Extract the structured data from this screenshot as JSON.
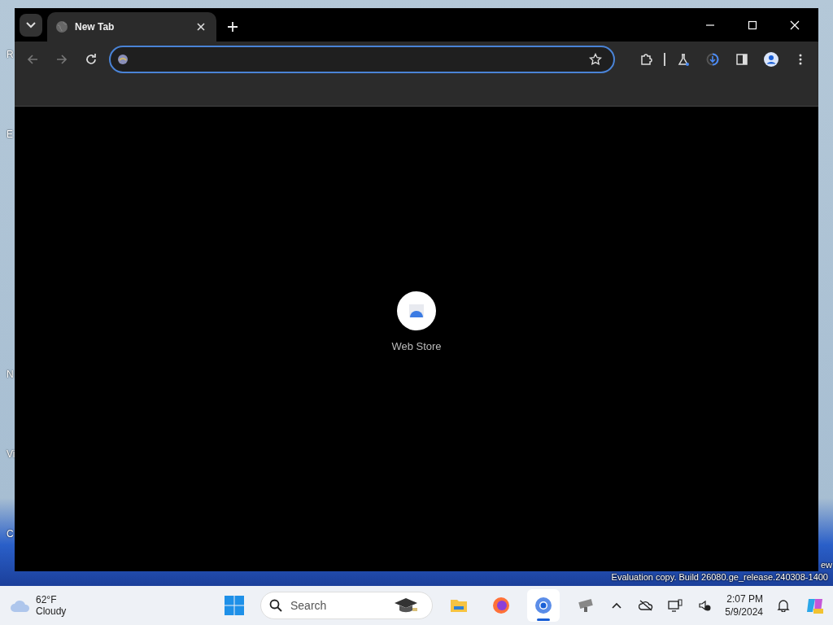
{
  "desktop": {
    "icon_labels": [
      "R",
      "E",
      "N",
      "Vi",
      "C"
    ],
    "watermark_lines": [
      "ew",
      "Evaluation copy. Build 26080.ge_release.240308-1400"
    ]
  },
  "browser": {
    "tabs": [
      {
        "title": "New Tab",
        "selected": true
      }
    ],
    "address_bar": {
      "focused": true
    },
    "shortcuts": [
      {
        "label": "Web Store"
      }
    ]
  },
  "taskbar": {
    "weather": {
      "temperature": "62°F",
      "condition": "Cloudy"
    },
    "search": {
      "placeholder": "Search"
    },
    "apps": [
      {
        "kind": "folder",
        "active": false
      },
      {
        "kind": "firefox",
        "active": false
      },
      {
        "kind": "chrome",
        "active": true
      },
      {
        "kind": "tool",
        "active": false
      }
    ],
    "clock": {
      "time": "2:07 PM",
      "date": "5/9/2024"
    }
  }
}
